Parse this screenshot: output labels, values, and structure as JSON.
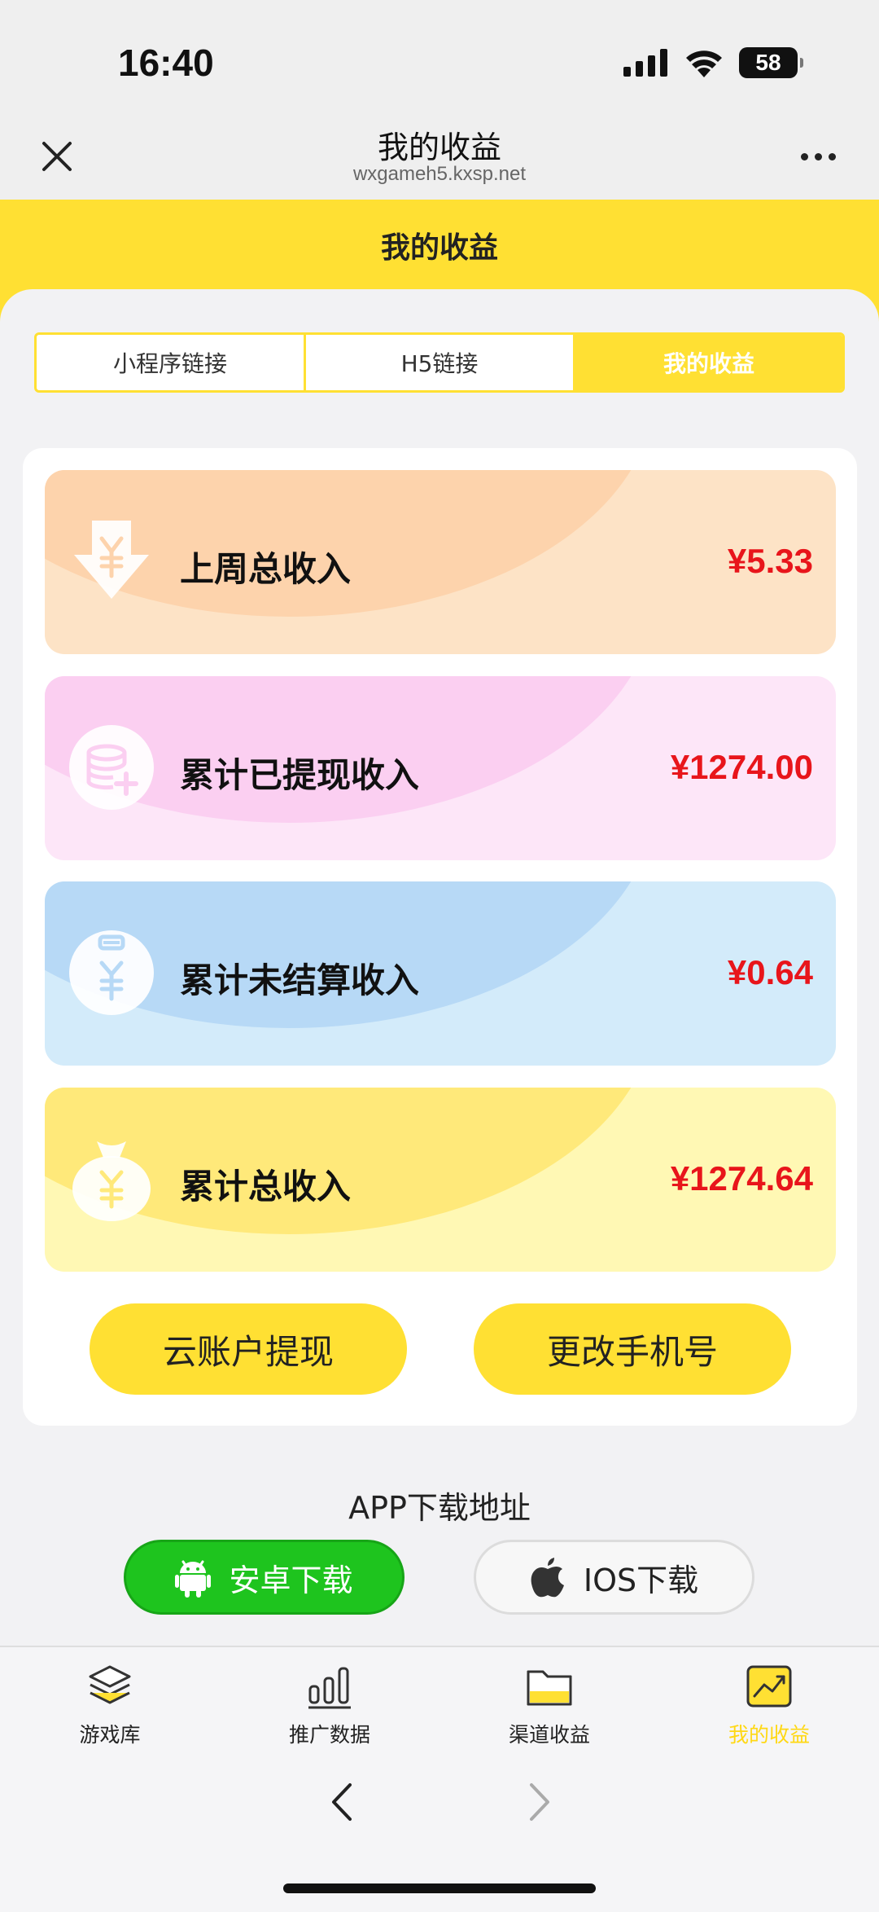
{
  "status_bar": {
    "time": "16:40",
    "battery": "58"
  },
  "browser": {
    "title": "我的收益",
    "url": "wxgameh5.kxsp.net"
  },
  "header": {
    "title": "我的收益"
  },
  "tabs": [
    {
      "label": "小程序链接",
      "active": false
    },
    {
      "label": "H5链接",
      "active": false
    },
    {
      "label": "我的收益",
      "active": true
    }
  ],
  "cards": [
    {
      "label": "上周总收入",
      "amount": "¥5.33",
      "icon": "download-yen-icon"
    },
    {
      "label": "累计已提现收入",
      "amount": "¥1274.00",
      "icon": "coins-plus-icon"
    },
    {
      "label": "累计未结算收入",
      "amount": "¥0.64",
      "icon": "yen-clipboard-icon"
    },
    {
      "label": "累计总收入",
      "amount": "¥1274.64",
      "icon": "money-bag-icon"
    }
  ],
  "actions": {
    "withdraw": "云账户提现",
    "change_phone": "更改手机号"
  },
  "download": {
    "title": "APP下载地址",
    "android": "安卓下载",
    "ios": "IOS下载"
  },
  "tabbar": [
    {
      "label": "游戏库",
      "icon": "layers-icon",
      "active": false
    },
    {
      "label": "推广数据",
      "icon": "bar-chart-icon",
      "active": false
    },
    {
      "label": "渠道收益",
      "icon": "folder-icon",
      "active": false
    },
    {
      "label": "我的收益",
      "icon": "trend-chart-icon",
      "active": true
    }
  ],
  "colors": {
    "accent": "#ffe033",
    "amount": "#e8151b",
    "android": "#1ec41e"
  }
}
